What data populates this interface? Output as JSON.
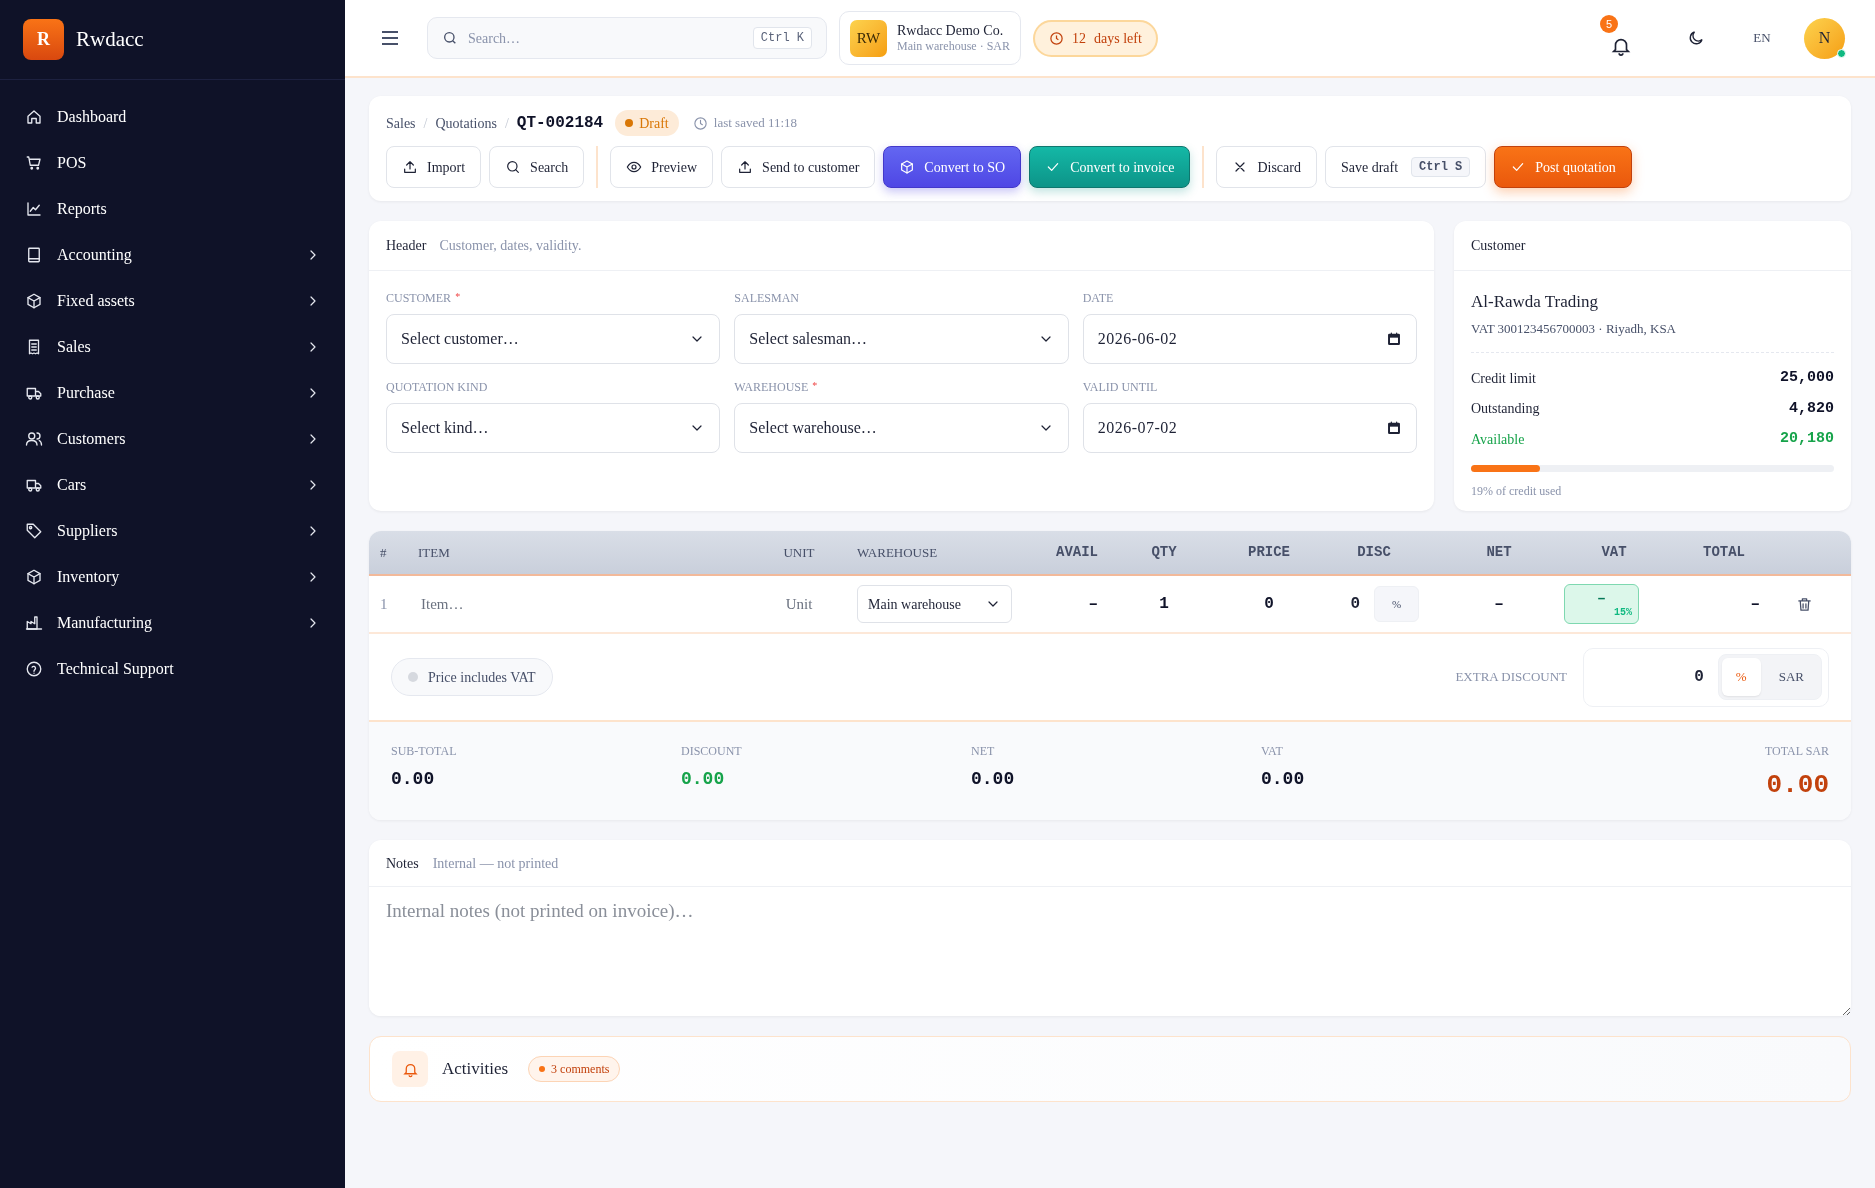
{
  "brand": {
    "logo_letter": "R",
    "name": "Rwdacc"
  },
  "sidebar": {
    "items": [
      {
        "label": "Dashboard",
        "expandable": false
      },
      {
        "label": "POS",
        "expandable": false
      },
      {
        "label": "Reports",
        "expandable": false
      },
      {
        "label": "Accounting",
        "expandable": true
      },
      {
        "label": "Fixed assets",
        "expandable": true
      },
      {
        "label": "Sales",
        "expandable": true
      },
      {
        "label": "Purchase",
        "expandable": true
      },
      {
        "label": "Customers",
        "expandable": true
      },
      {
        "label": "Cars",
        "expandable": true
      },
      {
        "label": "Suppliers",
        "expandable": true
      },
      {
        "label": "Inventory",
        "expandable": true
      },
      {
        "label": "Manufacturing",
        "expandable": true
      },
      {
        "label": "Technical Support",
        "expandable": false
      }
    ]
  },
  "topbar": {
    "search": {
      "placeholder": "Search…",
      "shortcut": "Ctrl K"
    },
    "company": {
      "initials": "RW",
      "name": "Rwdacc Demo Co.",
      "subtitle": "Main warehouse · SAR"
    },
    "trial": {
      "count": "12",
      "label": "days left"
    },
    "notifications": {
      "count": "5"
    },
    "language": "EN",
    "avatar": {
      "initial": "N",
      "online": true
    }
  },
  "document": {
    "breadcrumb": [
      "Sales",
      "Quotations"
    ],
    "breadcrumb_separators": [
      "/",
      "/"
    ],
    "number": "QT-002184",
    "status": "Draft",
    "last_saved": "last saved 11:18",
    "toolbar_groups": [
      [
        {
          "label": "Import",
          "kind": "outline"
        },
        {
          "label": "Search",
          "kind": "outline"
        }
      ],
      [
        {
          "label": "Preview",
          "kind": "outline"
        },
        {
          "label": "Send to customer",
          "kind": "outline"
        },
        {
          "label": "Convert to SO",
          "kind": "indigo"
        },
        {
          "label": "Convert to invoice",
          "kind": "teal"
        }
      ],
      [
        {
          "label": "Discard",
          "kind": "outline"
        },
        {
          "label": "Save draft",
          "kind": "outline",
          "shortcut": "Ctrl S"
        },
        {
          "label": "Post quotation",
          "kind": "orange"
        }
      ]
    ]
  },
  "header_card": {
    "title": "Header",
    "subtitle": "Customer, dates, validity.",
    "fields": [
      {
        "label": "CUSTOMER",
        "required_mark": "*",
        "kind": "select",
        "value": "Select customer…"
      },
      {
        "label": "SALESMAN",
        "kind": "select",
        "value": "Select salesman…"
      },
      {
        "label": "DATE",
        "kind": "date",
        "value": "2026-06-02"
      },
      {
        "label": "QUOTATION KIND",
        "kind": "select",
        "value": "Select kind…"
      },
      {
        "label": "WAREHOUSE",
        "required_mark": "*",
        "kind": "select",
        "value": "Select warehouse…"
      },
      {
        "label": "VALID UNTIL",
        "kind": "date",
        "value": "2026-07-02"
      }
    ]
  },
  "customer_card": {
    "title": "Customer",
    "name": "Al-Rawda Trading",
    "details": "VAT 300123456700003 · Riyadh, KSA",
    "rows": [
      {
        "label": "Credit limit",
        "value": "25,000",
        "kind": "normal"
      },
      {
        "label": "Outstanding",
        "value": "4,820",
        "kind": "normal"
      },
      {
        "label": "Available",
        "value": "20,180",
        "kind": "positive"
      }
    ],
    "level": 0.19,
    "credit_note": "19% of credit used"
  },
  "table": {
    "columns": [
      {
        "label": "#",
        "numeric": false
      },
      {
        "label": "ITEM",
        "numeric": false
      },
      {
        "label": "UNIT",
        "numeric": false
      },
      {
        "label": "WAREHOUSE",
        "numeric": false
      },
      {
        "label": "AVAIL",
        "numeric": true
      },
      {
        "label": "QTY",
        "numeric": true
      },
      {
        "label": "PRICE",
        "numeric": true
      },
      {
        "label": "DISC",
        "numeric": true
      },
      {
        "label": "NET",
        "numeric": true
      },
      {
        "label": "VAT",
        "numeric": true
      },
      {
        "label": "TOTAL",
        "numeric": true
      }
    ],
    "rows": [
      {
        "number": "1",
        "item_placeholder": "Item…",
        "unit": "Unit",
        "warehouse": "Main warehouse",
        "avail": "–",
        "qty": "1",
        "price": "0",
        "disc": "0",
        "disc_mode": "%",
        "net": "–",
        "vat": "–",
        "vat_rate": "15%",
        "total": "–"
      }
    ]
  },
  "price_includes_vat": {
    "label": "Price includes VAT",
    "on": false
  },
  "extra_discount": {
    "label": "EXTRA DISCOUNT",
    "value": "0",
    "modes": [
      {
        "label": "%",
        "selected": true
      },
      {
        "label": "SAR",
        "selected": false
      }
    ]
  },
  "totals": [
    {
      "label": "SUB-TOTAL",
      "value": "0.00",
      "kind": "normal"
    },
    {
      "label": "DISCOUNT",
      "value": "0.00",
      "kind": "discount"
    },
    {
      "label": "NET",
      "value": "0.00",
      "kind": "normal"
    },
    {
      "label": "VAT",
      "value": "0.00",
      "kind": "normal"
    },
    {
      "label": "TOTAL SAR",
      "value": "0.00",
      "kind": "grand"
    }
  ],
  "notes": {
    "title": "Notes",
    "subtitle": "Internal — not printed",
    "placeholder": "Internal notes (not printed on invoice)…"
  },
  "activities": {
    "title": "Activities",
    "badge": "3 comments"
  }
}
